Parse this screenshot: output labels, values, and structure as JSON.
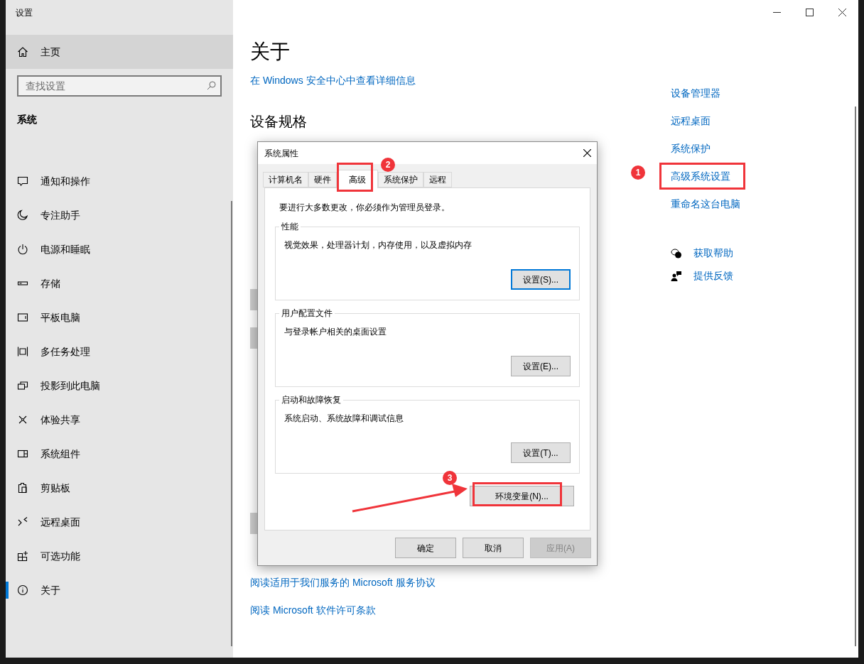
{
  "window": {
    "title": "设置"
  },
  "sidebar": {
    "home": "主页",
    "search": {
      "placeholder": "查找设置"
    },
    "section": "系统",
    "items": [
      {
        "label": "通知和操作",
        "selected": false
      },
      {
        "label": "专注助手",
        "selected": false
      },
      {
        "label": "电源和睡眠",
        "selected": false
      },
      {
        "label": "存储",
        "selected": false
      },
      {
        "label": "平板电脑",
        "selected": false
      },
      {
        "label": "多任务处理",
        "selected": false
      },
      {
        "label": "投影到此电脑",
        "selected": false
      },
      {
        "label": "体验共享",
        "selected": false
      },
      {
        "label": "系统组件",
        "selected": false
      },
      {
        "label": "剪贴板",
        "selected": false
      },
      {
        "label": "远程桌面",
        "selected": false
      },
      {
        "label": "可选功能",
        "selected": false
      },
      {
        "label": "关于",
        "selected": true
      }
    ]
  },
  "main": {
    "title": "关于",
    "security_link": "在 Windows 安全中心中查看详细信息",
    "spec_heading": "设备规格",
    "links": [
      "阅读适用于我们服务的 Microsoft 服务协议",
      "阅读 Microsoft 软件许可条款"
    ]
  },
  "related": {
    "links": [
      "设备管理器",
      "远程桌面",
      "系统保护",
      "高级系统设置",
      "重命名这台电脑"
    ],
    "help": [
      "获取帮助",
      "提供反馈"
    ]
  },
  "dialog": {
    "title": "系统属性",
    "tabs": [
      {
        "label": "计算机名",
        "selected": false
      },
      {
        "label": "硬件",
        "selected": false
      },
      {
        "label": "高级",
        "selected": true
      },
      {
        "label": "系统保护",
        "selected": false
      },
      {
        "label": "远程",
        "selected": false
      }
    ],
    "note": "要进行大多数更改，你必须作为管理员登录。",
    "groups": [
      {
        "title": "性能",
        "description": "视觉效果，处理器计划，内存使用，以及虚拟内存",
        "button": "设置(S)...",
        "focused": true
      },
      {
        "title": "用户配置文件",
        "description": "与登录帐户相关的桌面设置",
        "button": "设置(E)...",
        "focused": false
      },
      {
        "title": "启动和故障恢复",
        "description": "系统启动、系统故障和调试信息",
        "button": "设置(T)...",
        "focused": false
      }
    ],
    "env_button": "环境变量(N)...",
    "buttons": [
      {
        "label": "确定",
        "disabled": false
      },
      {
        "label": "取消",
        "disabled": false
      },
      {
        "label": "应用(A)",
        "disabled": true
      }
    ]
  },
  "annotations": [
    {
      "number": "1"
    },
    {
      "number": "2"
    },
    {
      "number": "3"
    }
  ]
}
